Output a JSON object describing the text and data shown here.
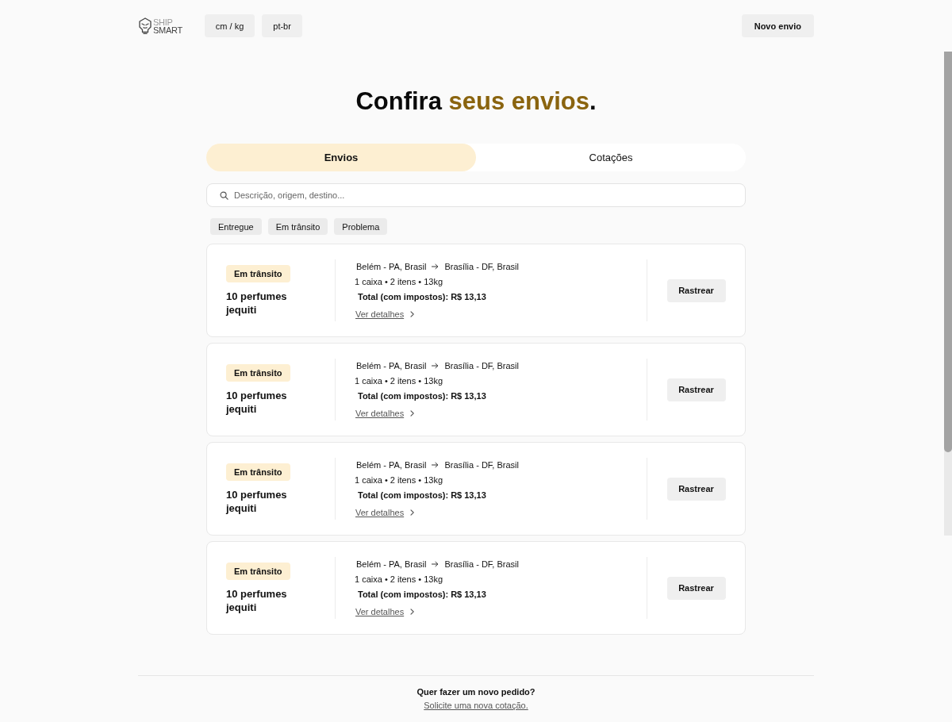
{
  "header": {
    "logo": {
      "top": "SHIP",
      "bottom": "SMART"
    },
    "units_button": "cm / kg",
    "language_button": "pt-br",
    "new_shipment_button": "Novo envio"
  },
  "heading": [
    {
      "text": "Confira ",
      "highlight": false
    },
    {
      "text": "seus envios",
      "highlight": true
    },
    {
      "text": ".",
      "highlight": false
    }
  ],
  "tabs": [
    {
      "label": "Envios",
      "selected": true
    },
    {
      "label": "Cotações",
      "selected": false
    }
  ],
  "search": {
    "placeholder": "Descrição, origem, destino..."
  },
  "filters": [
    {
      "label": "Entregue",
      "selected": false
    },
    {
      "label": "Em trânsito",
      "selected": false
    },
    {
      "label": "Problema",
      "selected": false
    }
  ],
  "shipments": [
    {
      "status": {
        "label": "Em trânsito",
        "color": "#fdefd2"
      },
      "title": "10 perfumes jequiti",
      "origin": "Belém - PA, Brasil",
      "destination": "Brasília - DF, Brasil",
      "summary": "1 caixa • 2 itens • 13kg",
      "total": "Total (com impostos): R$ 13,13",
      "details_link": "Ver detalhes",
      "button": "Rastrear"
    },
    {
      "status": {
        "label": "Em trânsito",
        "color": "#fdefd2"
      },
      "title": "10 perfumes jequiti",
      "origin": "Belém - PA, Brasil",
      "destination": "Brasília - DF, Brasil",
      "summary": "1 caixa • 2 itens • 13kg",
      "total": "Total (com impostos): R$ 13,13",
      "details_link": "Ver detalhes",
      "button": "Rastrear"
    },
    {
      "status": {
        "label": "Em trânsito",
        "color": "#fdefd2"
      },
      "title": "10 perfumes jequiti",
      "origin": "Belém - PA, Brasil",
      "destination": "Brasília - DF, Brasil",
      "summary": "1 caixa • 2 itens • 13kg",
      "total": "Total (com impostos): R$ 13,13",
      "details_link": "Ver detalhes",
      "button": "Rastrear"
    },
    {
      "status": {
        "label": "Em trânsito",
        "color": "#fdefd2"
      },
      "title": "10 perfumes jequiti",
      "origin": "Belém - PA, Brasil",
      "destination": "Brasília - DF, Brasil",
      "summary": "1 caixa • 2 itens • 13kg",
      "total": "Total (com impostos): R$ 13,13",
      "details_link": "Ver detalhes",
      "button": "Rastrear"
    }
  ],
  "footer": {
    "question": "Quer fazer um novo pedido?",
    "link": "Solicite uma nova cotação."
  }
}
